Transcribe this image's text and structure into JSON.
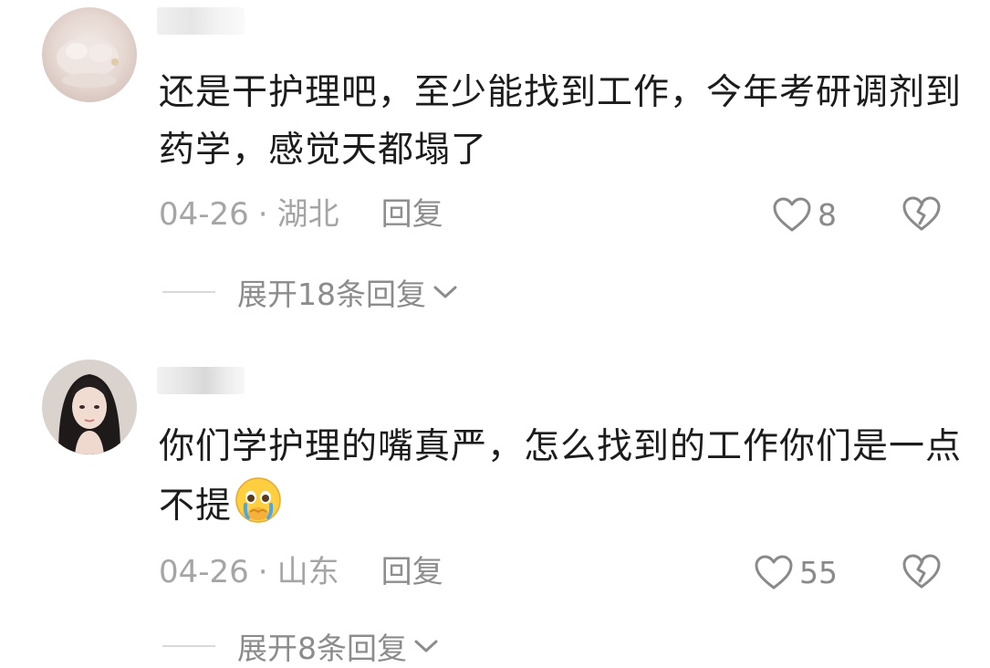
{
  "comments": [
    {
      "username": "",
      "text": "还是干护理吧，至少能找到工作，今年考研调剂到药学，感觉天都塌了",
      "date": "04-26",
      "separator": "·",
      "location": "湖北",
      "reply_label": "回复",
      "likes": "8",
      "expand_label": "展开18条回复"
    },
    {
      "username": "",
      "text": "你们学护理的嘴真严，怎么找到的工作你们是一点不提",
      "emoji": "crying-face-emoji",
      "date": "04-26",
      "separator": "·",
      "location": "山东",
      "reply_label": "回复",
      "likes": "55",
      "expand_label": "展开8条回复"
    }
  ],
  "colors": {
    "text": "#1c1c1c",
    "meta": "#a5a5a5",
    "icon": "#8a8a8a",
    "divider": "#d9d9d9",
    "background": "#ffffff"
  },
  "icons": [
    "heart-outline-icon",
    "broken-heart-icon",
    "chevron-down-icon"
  ]
}
